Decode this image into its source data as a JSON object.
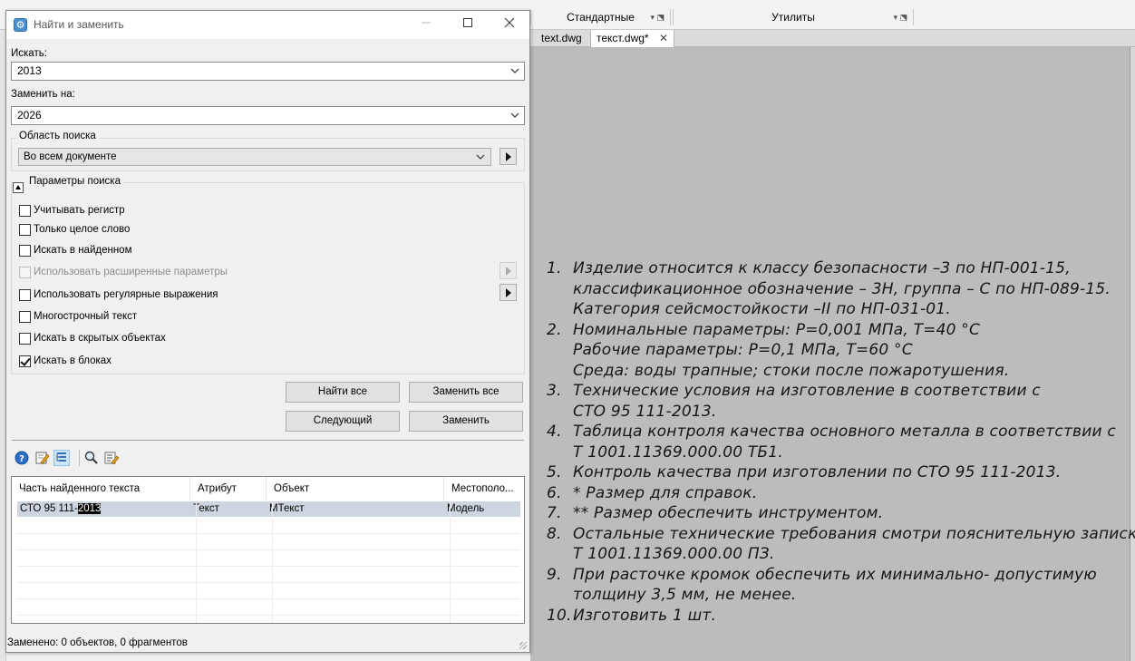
{
  "app": {
    "ribbon": {
      "group_standard": "Стандартные",
      "group_utilities": "Утилиты"
    },
    "tabs": [
      {
        "label": "text.dwg"
      },
      {
        "label": "текст.dwg*"
      }
    ]
  },
  "dialog": {
    "title": "Найти и заменить",
    "find_label": "Искать:",
    "find_value": "2013",
    "replace_label": "Заменить на:",
    "replace_value": "2026",
    "scope_group_label": "Область поиска",
    "scope_value": "Во всем документе",
    "params_group_label": "Параметры поиска",
    "options": [
      {
        "label": "Учитывать регистр",
        "checked": false,
        "enabled": true
      },
      {
        "label": "Только целое слово",
        "checked": false,
        "enabled": true
      },
      {
        "label": "Искать в найденном",
        "checked": false,
        "enabled": true
      },
      {
        "label": "Использовать расширенные параметры",
        "checked": false,
        "enabled": false
      },
      {
        "label": "Использовать регулярные выражения",
        "checked": false,
        "enabled": true
      },
      {
        "label": "Многострочный текст",
        "checked": false,
        "enabled": true
      },
      {
        "label": "Искать в скрытых объектах",
        "checked": false,
        "enabled": true
      },
      {
        "label": "Искать в блоках",
        "checked": true,
        "enabled": true
      }
    ],
    "buttons": {
      "find_all": "Найти все",
      "replace_all": "Заменить все",
      "next": "Следующий",
      "replace": "Заменить"
    },
    "toolbar_icons": [
      "help-icon",
      "edit-icon",
      "tree-icon",
      "zoom-icon",
      "properties-icon"
    ],
    "results": {
      "columns": [
        "Часть найденного текста",
        "Атрибут",
        "Объект",
        "Местополо..."
      ],
      "rows": [
        {
          "text_prefix": "СТО 95 111-",
          "text_match": "2013",
          "attribute": "Текст",
          "object": "МТекст",
          "location": "Модель"
        }
      ]
    },
    "status": "Заменено: 0 объектов, 0 фрагментов"
  },
  "drawing_notes": [
    {
      "num": "1.",
      "lines": [
        "Изделие относится к классу безопасности –3 по НП-001-15,",
        "классификационное обозначение – 3Н, группа – С по НП-089-15.",
        "Категория сейсмостойкости –II по НП-031-01."
      ]
    },
    {
      "num": "2.",
      "lines": [
        "Номинальные параметры: Р=0,001 МПа,  Т=40 °С",
        "Рабочие параметры: Р=0,1 МПа,  Т=60 °С",
        "Среда: воды трапные; стоки после пожаротушения."
      ]
    },
    {
      "num": "3.",
      "lines": [
        "Технические условия на изготовление в соответствии с",
        "  СТО 95 111-2013."
      ]
    },
    {
      "num": "4.",
      "lines": [
        "Таблица контроля качества основного металла в соответствии с",
        "Т 1001.11369.000.00 ТБ1."
      ]
    },
    {
      "num": "5.",
      "lines": [
        "Контроль качества при изготовлении по СТО 95 111-2013."
      ]
    },
    {
      "num": "6.",
      "lines": [
        "* Размер для справок."
      ]
    },
    {
      "num": "7.",
      "lines": [
        "** Размер обеспечить инструментом."
      ]
    },
    {
      "num": "8.",
      "lines": [
        "Остальные технические требования смотри пояснительную записку",
        "Т 1001.11369.000.00 ПЗ."
      ]
    },
    {
      "num": "9.",
      "lines": [
        "При расточке кромок обеспечить их минимально- допустимую",
        "толщину 3,5 мм, не менее."
      ]
    },
    {
      "num": "10.",
      "lines": [
        "Изготовить 1 шт."
      ]
    }
  ]
}
